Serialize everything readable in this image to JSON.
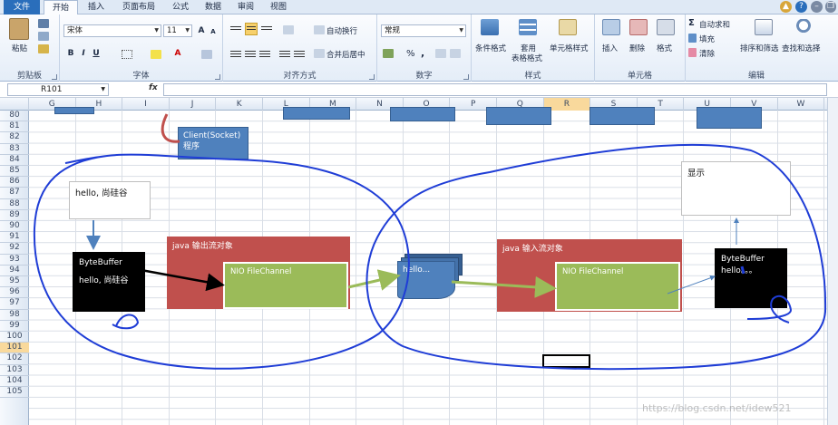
{
  "tabs": [
    {
      "label": "文件",
      "style": "file"
    },
    {
      "label": "开始",
      "style": "active"
    },
    {
      "label": "插入",
      "style": ""
    },
    {
      "label": "页面布局",
      "style": ""
    },
    {
      "label": "公式",
      "style": ""
    },
    {
      "label": "数据",
      "style": ""
    },
    {
      "label": "审阅",
      "style": ""
    },
    {
      "label": "视图",
      "style": ""
    }
  ],
  "ribbon": {
    "clipboard": {
      "label": "剪贴板",
      "paste": "粘贴"
    },
    "font": {
      "label": "字体",
      "name": "宋体",
      "size": "11",
      "bold": "B",
      "italic": "I",
      "underline": "U"
    },
    "alignment": {
      "label": "对齐方式",
      "wrap": "自动换行",
      "merge": "合并后居中"
    },
    "number": {
      "label": "数字",
      "format": "常规",
      "percent": "%",
      "comma": ","
    },
    "styles": {
      "label": "样式",
      "conditional": "条件格式",
      "table1": "套用",
      "table2": "表格格式",
      "cell": "单元格样式"
    },
    "cells": {
      "label": "单元格",
      "insert": "插入",
      "delete": "删除",
      "format": "格式"
    },
    "editing": {
      "label": "编辑",
      "autosum": "自动求和",
      "fill": "填充",
      "clear": "清除",
      "sort": "排序和筛选",
      "find": "查找和选择"
    }
  },
  "formula_bar": {
    "cell": "R101",
    "fx": "fx",
    "value": ""
  },
  "columns": [
    "G",
    "H",
    "I",
    "J",
    "K",
    "L",
    "M",
    "N",
    "O",
    "P",
    "Q",
    "R",
    "S",
    "T",
    "U",
    "V",
    "W"
  ],
  "selected_column": "R",
  "rows": [
    "80",
    "81",
    "82",
    "83",
    "84",
    "85",
    "86",
    "87",
    "88",
    "89",
    "90",
    "91",
    "92",
    "93",
    "94",
    "95",
    "96",
    "97",
    "98",
    "99",
    "100",
    "101",
    "102",
    "103",
    "104",
    "105"
  ],
  "selected_row": "101",
  "shapes": {
    "client": "Client(Socket)\n程序",
    "hello_box": "hello, 尚硅谷",
    "bytebuffer_left": "ByteBuffer",
    "bytebuffer_left_text": "hello, 尚硅谷",
    "output_stream": "java 输出流对象",
    "nio_left": "NIO FileChannel",
    "file_doc": "hello...",
    "input_stream": "java 输入流对象",
    "nio_right": "NIO FileChannel",
    "bytebuffer_right": "ByteBuffer",
    "bytebuffer_right_text": "hello。。。",
    "display": "显示"
  },
  "watermark": "https://blog.csdn.net/idew521",
  "colors": {
    "accent": "#2a6ebb",
    "red_shape": "#c0504d",
    "green_shape": "#9bbb59",
    "blue_shape": "#4f81bd",
    "pen": "#1f3dd6"
  }
}
